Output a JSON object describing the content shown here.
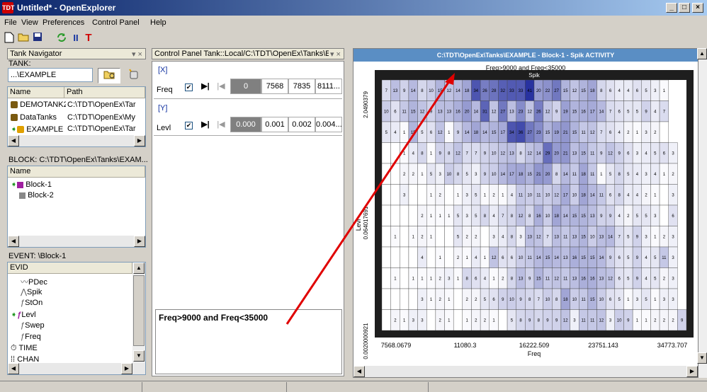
{
  "window": {
    "title": "Untitled* - OpenExplorer",
    "icon_text": "TDT",
    "minimize": "_",
    "maximize": "□",
    "close": "×"
  },
  "menu": [
    "File",
    "View",
    "Preferences",
    "Control Panel",
    "Help"
  ],
  "toolbar": {
    "icons": [
      "new-file-icon",
      "open-folder-icon",
      "save-icon",
      "refresh-icon",
      "pause-icon",
      "tank-icon"
    ],
    "pause_glyph": "II",
    "t_glyph": "T"
  },
  "tank_navigator": {
    "header": "Tank Navigator",
    "pin": "▾ ×",
    "tank_label": "TANK:",
    "tank_value": "...\\EXAMPLE",
    "columns": [
      "Name",
      "Path"
    ],
    "rows": [
      {
        "name": "DEMOTANK2",
        "path": "C:\\TDT\\OpenEx\\Tar"
      },
      {
        "name": "DataTanks",
        "path": "C:\\TDT\\OpenEx\\My"
      },
      {
        "name": "EXAMPLE",
        "path": "C:\\TDT\\OpenEx\\Tar"
      }
    ]
  },
  "block_panel": {
    "header": "BLOCK: C:\\TDT\\OpenEx\\Tanks\\EXAM...",
    "column": "Name",
    "rows": [
      "Block-1",
      "Block-2"
    ]
  },
  "event_panel": {
    "header": "EVENT: \\Block-1",
    "column": "EVID",
    "rows": [
      "PDec",
      "Spik",
      "StOn",
      "Levl",
      "Swep",
      "Freq",
      "TIME",
      "CHAN"
    ]
  },
  "control_panel": {
    "header": "Control Panel  Tank::Local/C:\\TDT\\OpenEx\\Tanks\\E",
    "pin": "▾ ×",
    "x_label": "[X]",
    "y_label": "[Y]",
    "freq": {
      "label": "Freq",
      "current": "0",
      "values": [
        "7568",
        "7835",
        "8111..."
      ]
    },
    "levl": {
      "label": "Levl",
      "current": "0.000",
      "values": [
        "0.001",
        "0.002",
        "0.004..."
      ]
    },
    "filter_text": "Freq>9000 and Freq<35000"
  },
  "chart_window": {
    "title": "C:\\TDT\\OpenEx\\Tanks\\EXAMPLE - Block-1 - Spik ACTIVITY"
  },
  "chart_data": {
    "type": "heatmap",
    "title": "Freq>9000 and Freq<35000",
    "subtitle": "Spik",
    "xlabel": "Freq",
    "ylabel": "Levl",
    "x_ticks": [
      "7568.0679",
      "11080.3",
      "16222.509",
      "23751.143",
      "34773.707"
    ],
    "y_ticks": [
      "2.0490379",
      "0.064017691",
      "0.0020000921"
    ],
    "rows": [
      [
        7,
        13,
        9,
        14,
        8,
        10,
        15,
        12,
        14,
        18,
        34,
        26,
        28,
        32,
        33,
        33,
        41,
        20,
        22,
        27,
        15,
        12,
        15,
        18,
        8,
        6,
        4,
        4,
        6,
        5,
        3,
        1
      ],
      [
        10,
        6,
        11,
        15,
        12,
        9,
        13,
        13,
        16,
        20,
        14,
        31,
        12,
        27,
        13,
        23,
        12,
        26,
        12,
        9,
        19,
        15,
        16,
        17,
        14,
        7,
        6,
        5,
        5,
        9,
        4,
        7
      ],
      [
        5,
        4,
        1,
        15,
        5,
        6,
        12,
        1,
        9,
        14,
        18,
        14,
        15,
        17,
        34,
        36,
        27,
        23,
        15,
        19,
        21,
        15,
        11,
        12,
        7,
        6,
        4,
        2,
        1,
        3,
        2,
        0
      ],
      [
        0,
        0,
        1,
        4,
        8,
        1,
        9,
        8,
        12,
        7,
        7,
        9,
        10,
        12,
        13,
        8,
        12,
        14,
        29,
        20,
        21,
        13,
        15,
        11,
        9,
        12,
        9,
        6,
        3,
        4,
        5,
        6,
        3
      ],
      [
        0,
        0,
        2,
        2,
        1,
        5,
        3,
        10,
        8,
        5,
        3,
        9,
        10,
        14,
        17,
        18,
        15,
        21,
        20,
        8,
        14,
        11,
        18,
        11,
        1,
        5,
        8,
        5,
        4,
        3,
        4,
        1,
        2
      ],
      [
        0,
        0,
        3,
        0,
        0,
        1,
        2,
        0,
        1,
        3,
        5,
        1,
        2,
        1,
        4,
        11,
        10,
        11,
        10,
        12,
        17,
        10,
        18,
        14,
        11,
        6,
        8,
        4,
        4,
        2,
        1,
        0,
        3
      ],
      [
        0,
        0,
        0,
        0,
        2,
        1,
        1,
        1,
        5,
        3,
        5,
        8,
        4,
        7,
        8,
        12,
        8,
        16,
        10,
        18,
        14,
        15,
        15,
        13,
        9,
        9,
        4,
        2,
        5,
        5,
        3,
        0,
        6
      ],
      [
        0,
        1,
        0,
        1,
        2,
        1,
        0,
        0,
        5,
        2,
        2,
        0,
        3,
        4,
        8,
        3,
        13,
        12,
        7,
        13,
        11,
        13,
        15,
        10,
        13,
        14,
        7,
        5,
        9,
        3,
        1,
        2,
        3
      ],
      [
        0,
        0,
        0,
        0,
        4,
        0,
        1,
        0,
        2,
        1,
        4,
        1,
        12,
        6,
        6,
        10,
        11,
        14,
        15,
        14,
        13,
        16,
        15,
        15,
        14,
        9,
        6,
        5,
        9,
        4,
        5,
        11,
        3
      ],
      [
        0,
        1,
        0,
        1,
        1,
        1,
        2,
        3,
        1,
        8,
        6,
        4,
        1,
        2,
        8,
        13,
        9,
        15,
        11,
        12,
        11,
        13,
        16,
        16,
        13,
        12,
        6,
        5,
        9,
        4,
        5,
        2,
        3
      ],
      [
        0,
        0,
        0,
        0,
        3,
        1,
        2,
        1,
        0,
        2,
        2,
        5,
        6,
        9,
        10,
        9,
        8,
        7,
        10,
        8,
        18,
        10,
        11,
        15,
        10,
        6,
        5,
        1,
        3,
        5,
        1,
        3,
        3
      ],
      [
        0,
        2,
        1,
        3,
        3,
        0,
        2,
        1,
        0,
        1,
        2,
        2,
        1,
        0,
        5,
        8,
        9,
        8,
        9,
        9,
        12,
        3,
        11,
        11,
        12,
        3,
        10,
        9,
        1,
        1,
        2,
        2,
        2,
        9
      ]
    ]
  },
  "status": {
    "text": ""
  }
}
